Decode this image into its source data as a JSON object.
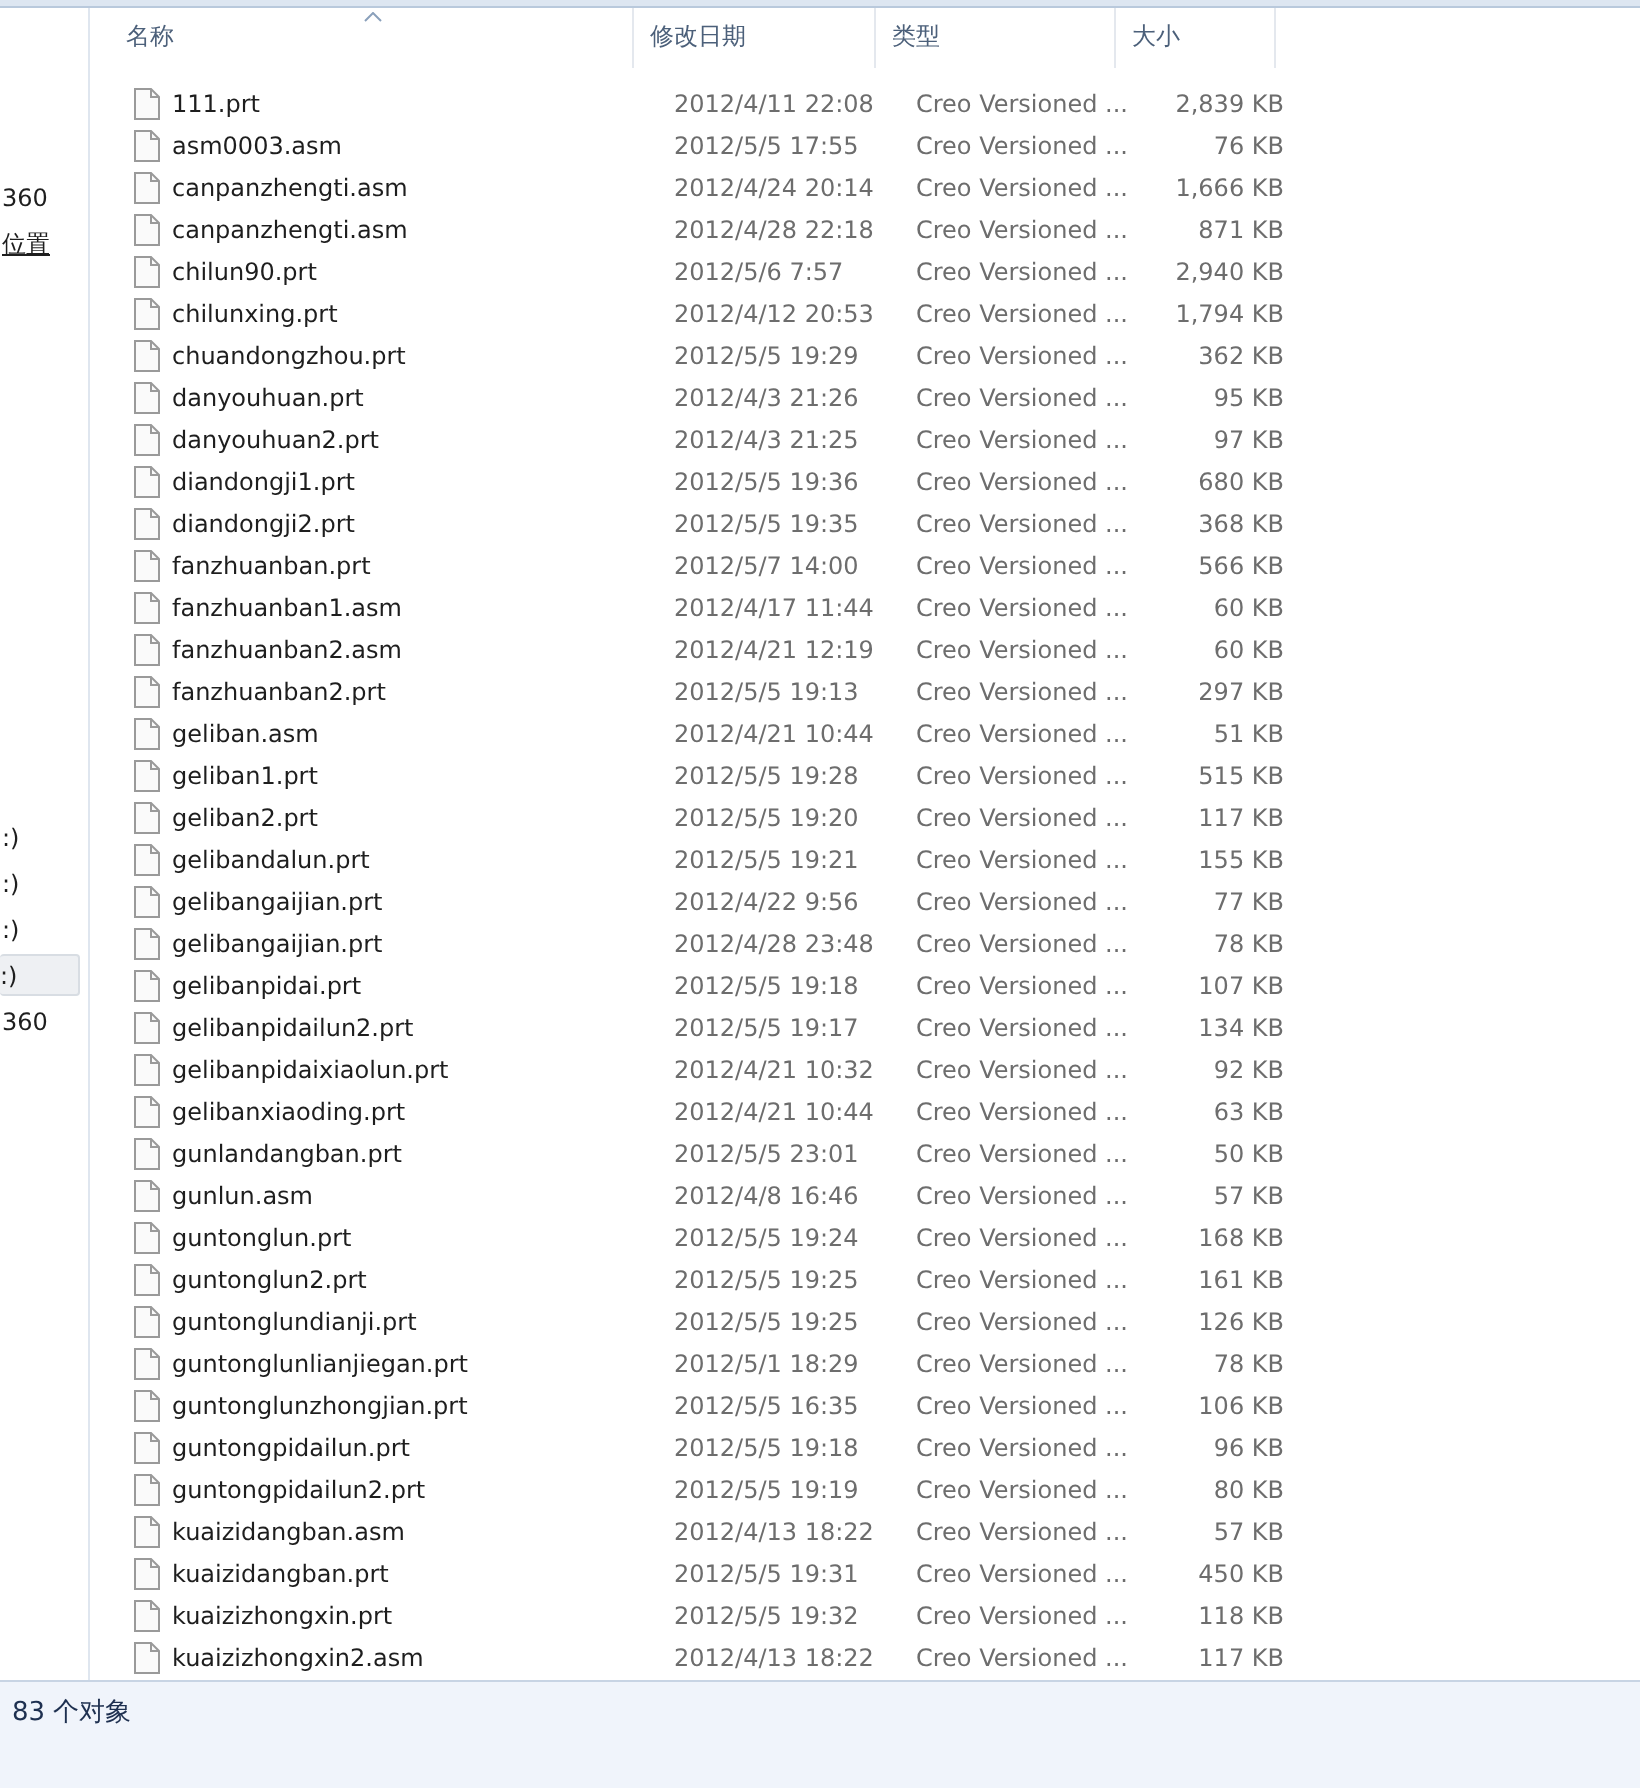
{
  "sidebar": {
    "groups": [
      {
        "items": [
          {
            "label": "360",
            "selected": false,
            "link": false
          },
          {
            "label": "位置",
            "selected": false,
            "link": true
          }
        ]
      },
      {
        "items": [
          {
            "label": ":)",
            "selected": false,
            "link": false
          },
          {
            "label": ":)",
            "selected": false,
            "link": false
          },
          {
            "label": ":)",
            "selected": false,
            "link": false
          },
          {
            "label": ":)",
            "selected": true,
            "link": false
          },
          {
            "label": "360",
            "selected": false,
            "link": false
          }
        ]
      }
    ]
  },
  "table": {
    "columns": [
      {
        "label": "名称",
        "sorted": true
      },
      {
        "label": "修改日期",
        "sorted": false
      },
      {
        "label": "类型",
        "sorted": false
      },
      {
        "label": "大小",
        "sorted": false
      }
    ],
    "rows": [
      {
        "name": "111.prt",
        "date": "2012/4/11 22:08",
        "type": "Creo Versioned ...",
        "size": "2,839 KB"
      },
      {
        "name": "asm0003.asm",
        "date": "2012/5/5 17:55",
        "type": "Creo Versioned ...",
        "size": "76 KB"
      },
      {
        "name": "canpanzhengti.asm",
        "date": "2012/4/24 20:14",
        "type": "Creo Versioned ...",
        "size": "1,666 KB"
      },
      {
        "name": "canpanzhengti.asm",
        "date": "2012/4/28 22:18",
        "type": "Creo Versioned ...",
        "size": "871 KB"
      },
      {
        "name": "chilun90.prt",
        "date": "2012/5/6 7:57",
        "type": "Creo Versioned ...",
        "size": "2,940 KB"
      },
      {
        "name": "chilunxing.prt",
        "date": "2012/4/12 20:53",
        "type": "Creo Versioned ...",
        "size": "1,794 KB"
      },
      {
        "name": "chuandongzhou.prt",
        "date": "2012/5/5 19:29",
        "type": "Creo Versioned ...",
        "size": "362 KB"
      },
      {
        "name": "danyouhuan.prt",
        "date": "2012/4/3 21:26",
        "type": "Creo Versioned ...",
        "size": "95 KB"
      },
      {
        "name": "danyouhuan2.prt",
        "date": "2012/4/3 21:25",
        "type": "Creo Versioned ...",
        "size": "97 KB"
      },
      {
        "name": "diandongji1.prt",
        "date": "2012/5/5 19:36",
        "type": "Creo Versioned ...",
        "size": "680 KB"
      },
      {
        "name": "diandongji2.prt",
        "date": "2012/5/5 19:35",
        "type": "Creo Versioned ...",
        "size": "368 KB"
      },
      {
        "name": "fanzhuanban.prt",
        "date": "2012/5/7 14:00",
        "type": "Creo Versioned ...",
        "size": "566 KB"
      },
      {
        "name": "fanzhuanban1.asm",
        "date": "2012/4/17 11:44",
        "type": "Creo Versioned ...",
        "size": "60 KB"
      },
      {
        "name": "fanzhuanban2.asm",
        "date": "2012/4/21 12:19",
        "type": "Creo Versioned ...",
        "size": "60 KB"
      },
      {
        "name": "fanzhuanban2.prt",
        "date": "2012/5/5 19:13",
        "type": "Creo Versioned ...",
        "size": "297 KB"
      },
      {
        "name": "geliban.asm",
        "date": "2012/4/21 10:44",
        "type": "Creo Versioned ...",
        "size": "51 KB"
      },
      {
        "name": "geliban1.prt",
        "date": "2012/5/5 19:28",
        "type": "Creo Versioned ...",
        "size": "515 KB"
      },
      {
        "name": "geliban2.prt",
        "date": "2012/5/5 19:20",
        "type": "Creo Versioned ...",
        "size": "117 KB"
      },
      {
        "name": "gelibandalun.prt",
        "date": "2012/5/5 19:21",
        "type": "Creo Versioned ...",
        "size": "155 KB"
      },
      {
        "name": "gelibangaijian.prt",
        "date": "2012/4/22 9:56",
        "type": "Creo Versioned ...",
        "size": "77 KB"
      },
      {
        "name": "gelibangaijian.prt",
        "date": "2012/4/28 23:48",
        "type": "Creo Versioned ...",
        "size": "78 KB"
      },
      {
        "name": "gelibanpidai.prt",
        "date": "2012/5/5 19:18",
        "type": "Creo Versioned ...",
        "size": "107 KB"
      },
      {
        "name": "gelibanpidailun2.prt",
        "date": "2012/5/5 19:17",
        "type": "Creo Versioned ...",
        "size": "134 KB"
      },
      {
        "name": "gelibanpidaixiaolun.prt",
        "date": "2012/4/21 10:32",
        "type": "Creo Versioned ...",
        "size": "92 KB"
      },
      {
        "name": "gelibanxiaoding.prt",
        "date": "2012/4/21 10:44",
        "type": "Creo Versioned ...",
        "size": "63 KB"
      },
      {
        "name": "gunlandangban.prt",
        "date": "2012/5/5 23:01",
        "type": "Creo Versioned ...",
        "size": "50 KB"
      },
      {
        "name": "gunlun.asm",
        "date": "2012/4/8 16:46",
        "type": "Creo Versioned ...",
        "size": "57 KB"
      },
      {
        "name": "guntonglun.prt",
        "date": "2012/5/5 19:24",
        "type": "Creo Versioned ...",
        "size": "168 KB"
      },
      {
        "name": "guntonglun2.prt",
        "date": "2012/5/5 19:25",
        "type": "Creo Versioned ...",
        "size": "161 KB"
      },
      {
        "name": "guntonglundianji.prt",
        "date": "2012/5/5 19:25",
        "type": "Creo Versioned ...",
        "size": "126 KB"
      },
      {
        "name": "guntonglunlianjiegan.prt",
        "date": "2012/5/1 18:29",
        "type": "Creo Versioned ...",
        "size": "78 KB"
      },
      {
        "name": "guntonglunzhongjian.prt",
        "date": "2012/5/5 16:35",
        "type": "Creo Versioned ...",
        "size": "106 KB"
      },
      {
        "name": "guntongpidailun.prt",
        "date": "2012/5/5 19:18",
        "type": "Creo Versioned ...",
        "size": "96 KB"
      },
      {
        "name": "guntongpidailun2.prt",
        "date": "2012/5/5 19:19",
        "type": "Creo Versioned ...",
        "size": "80 KB"
      },
      {
        "name": "kuaizidangban.asm",
        "date": "2012/4/13 18:22",
        "type": "Creo Versioned ...",
        "size": "57 KB"
      },
      {
        "name": "kuaizidangban.prt",
        "date": "2012/5/5 19:31",
        "type": "Creo Versioned ...",
        "size": "450 KB"
      },
      {
        "name": "kuaizizhongxin.prt",
        "date": "2012/5/5 19:32",
        "type": "Creo Versioned ...",
        "size": "118 KB"
      },
      {
        "name": "kuaizizhongxin2.asm",
        "date": "2012/4/13 18:22",
        "type": "Creo Versioned ...",
        "size": "117 KB"
      }
    ]
  },
  "status_bar": {
    "text": "83 个对象"
  }
}
